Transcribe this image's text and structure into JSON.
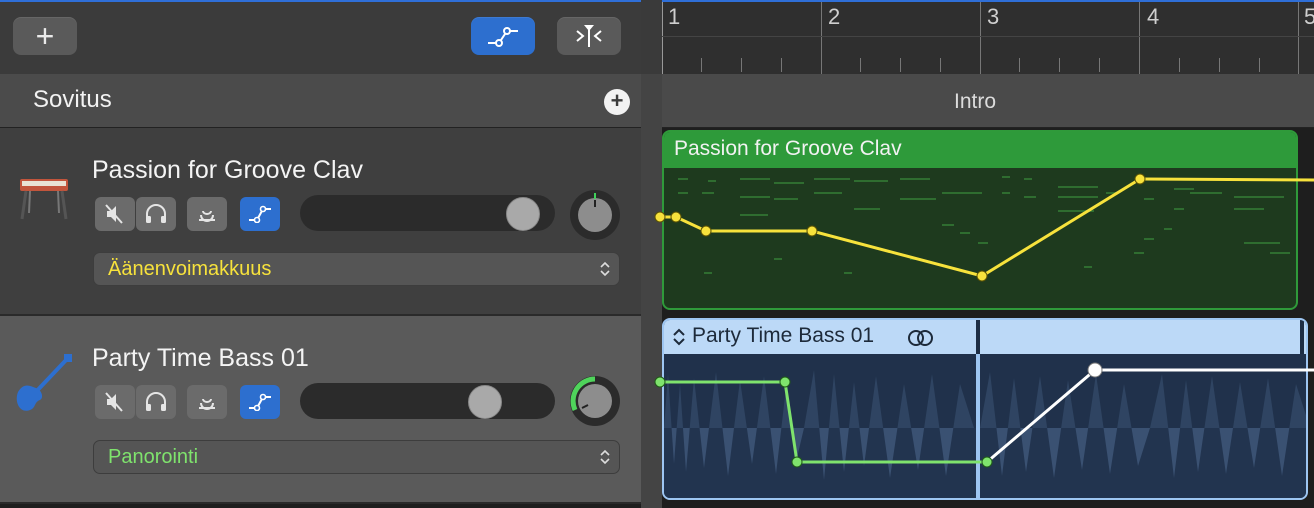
{
  "header": {
    "add_label": "+",
    "arrangement_label": "Sovitus",
    "arrangement_add": "+"
  },
  "ruler": {
    "bars": [
      "1",
      "2",
      "3",
      "4",
      "5"
    ]
  },
  "section": {
    "label": "Intro"
  },
  "tracks": [
    {
      "name": "Passion for Groove Clav",
      "icon": "keyboard-instrument-icon",
      "automation_param": "Äänenvoimakkuus",
      "param_color": "#f7e23c",
      "volume_level": 0.93,
      "region_title": "Passion for Groove Clav"
    },
    {
      "name": "Party Time Bass 01",
      "icon": "bass-guitar-icon",
      "automation_param": "Panorointi",
      "param_color": "#7fe36d",
      "volume_level": 0.76,
      "region_title": "Party Time Bass 01"
    }
  ],
  "colors": {
    "accent_blue": "#2d6fcf",
    "clav_region": "#2e9a3a",
    "bass_region": "#bcd9f7"
  }
}
